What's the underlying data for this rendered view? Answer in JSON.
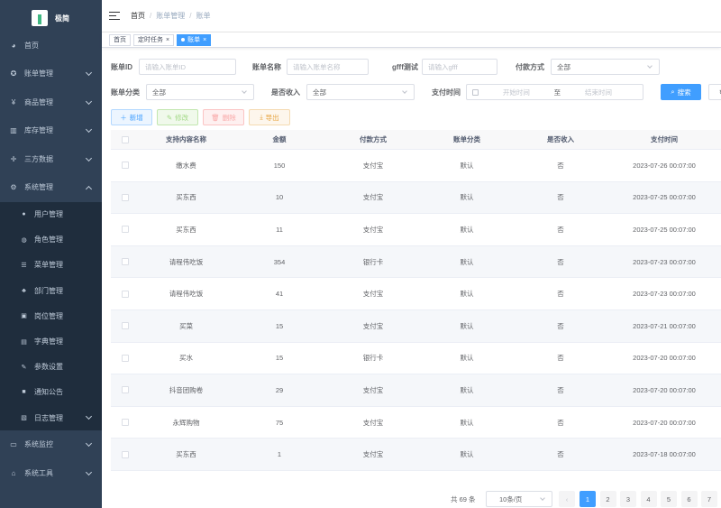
{
  "app": {
    "title": "极简"
  },
  "sidebar": {
    "items": [
      {
        "label": "首页",
        "icon": "dashboard-icon"
      },
      {
        "label": "账单管理",
        "icon": "bill-icon"
      },
      {
        "label": "商品管理",
        "icon": "yen-icon"
      },
      {
        "label": "库存管理",
        "icon": "warehouse-icon"
      },
      {
        "label": "三方数据",
        "icon": "cross-icon"
      },
      {
        "label": "系统管理",
        "icon": "gear-icon"
      }
    ],
    "sub_items": [
      {
        "label": "用户管理",
        "icon": "user-icon"
      },
      {
        "label": "角色管理",
        "icon": "peoples-icon"
      },
      {
        "label": "菜单管理",
        "icon": "tree-table-icon"
      },
      {
        "label": "部门管理",
        "icon": "tree-icon"
      },
      {
        "label": "岗位管理",
        "icon": "post-icon"
      },
      {
        "label": "字典管理",
        "icon": "dict-icon"
      },
      {
        "label": "参数设置",
        "icon": "edit-icon"
      },
      {
        "label": "通知公告",
        "icon": "message-icon"
      },
      {
        "label": "日志管理",
        "icon": "log-icon"
      }
    ],
    "bottom_items": [
      {
        "label": "系统监控",
        "icon": "monitor-icon"
      },
      {
        "label": "系统工具",
        "icon": "tool-icon"
      }
    ]
  },
  "breadcrumb": {
    "home": "首页",
    "mid": "账单管理",
    "last": "账单"
  },
  "tags": [
    {
      "label": "首页"
    },
    {
      "label": "定时任务"
    },
    {
      "label": "账单"
    }
  ],
  "search": {
    "bill_id_label": "账单ID",
    "bill_id_placeholder": "请输入账单ID",
    "bill_name_label": "账单名称",
    "bill_name_placeholder": "请输入账单名称",
    "gfff_label": "gfff测试",
    "gfff_placeholder": "请输入gfff",
    "pay_method_label": "付款方式",
    "pay_method_value": "全部",
    "category_label": "账单分类",
    "category_value": "全部",
    "income_label": "是否收入",
    "income_value": "全部",
    "pay_time_label": "支付时间",
    "start_placeholder": "开始时间",
    "range_sep": "至",
    "end_placeholder": "结束时间",
    "search_button": "搜索"
  },
  "toolbar": {
    "add": "新增",
    "edit": "修改",
    "delete": "删除",
    "export": "导出"
  },
  "table": {
    "headers": [
      "支持内容名称",
      "金额",
      "付款方式",
      "账单分类",
      "是否收入",
      "支付时间"
    ],
    "rows": [
      [
        "缴水费",
        "150",
        "支付宝",
        "默认",
        "否",
        "2023-07-26 00:07:00"
      ],
      [
        "买东西",
        "10",
        "支付宝",
        "默认",
        "否",
        "2023-07-25 00:07:00"
      ],
      [
        "买东西",
        "11",
        "支付宝",
        "默认",
        "否",
        "2023-07-25 00:07:00"
      ],
      [
        "请程伟吃饭",
        "354",
        "银行卡",
        "默认",
        "否",
        "2023-07-23 00:07:00"
      ],
      [
        "请程伟吃饭",
        "41",
        "支付宝",
        "默认",
        "否",
        "2023-07-23 00:07:00"
      ],
      [
        "买菜",
        "15",
        "支付宝",
        "默认",
        "否",
        "2023-07-21 00:07:00"
      ],
      [
        "买水",
        "15",
        "银行卡",
        "默认",
        "否",
        "2023-07-20 00:07:00"
      ],
      [
        "抖音团购卷",
        "29",
        "支付宝",
        "默认",
        "否",
        "2023-07-20 00:07:00"
      ],
      [
        "永辉购物",
        "75",
        "支付宝",
        "默认",
        "否",
        "2023-07-20 00:07:00"
      ],
      [
        "买东西",
        "1",
        "支付宝",
        "默认",
        "否",
        "2023-07-18 00:07:00"
      ]
    ]
  },
  "pagination": {
    "total": "共 69 条",
    "page_size": "10条/页",
    "prev": "‹",
    "pages": [
      "1",
      "2",
      "3",
      "4",
      "5",
      "6",
      "7"
    ],
    "current": "1"
  },
  "colors": {
    "sidebar_bg": "#304156",
    "submenu_bg": "#1f2d3d",
    "primary": "#409eff"
  }
}
